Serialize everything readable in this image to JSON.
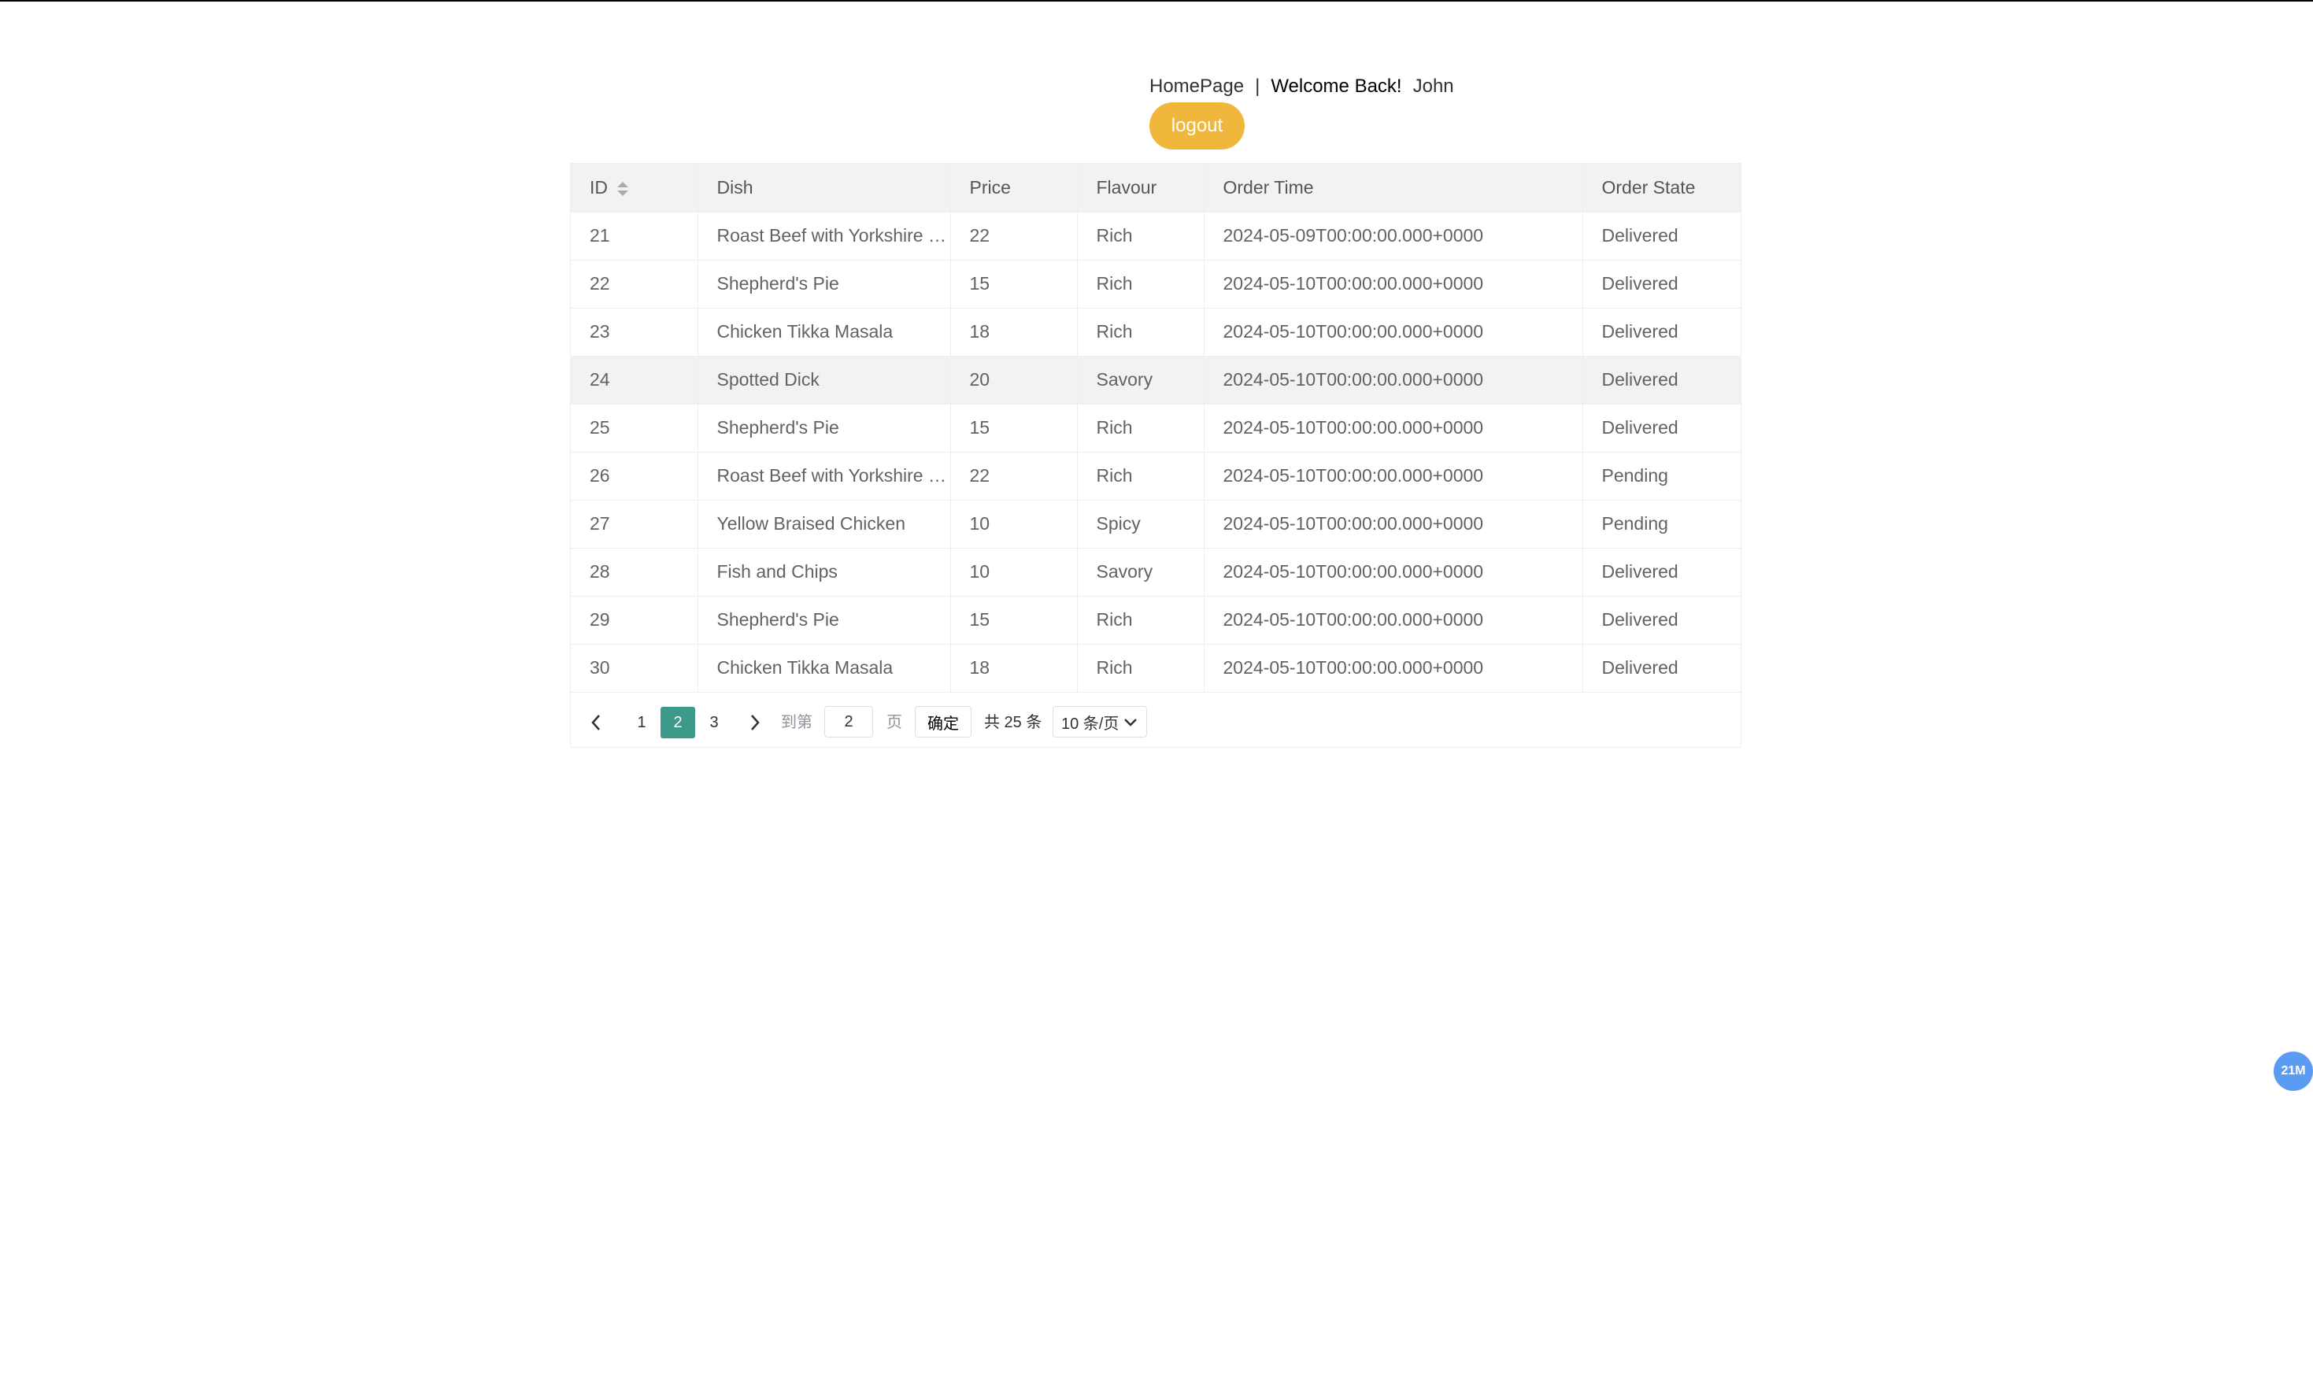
{
  "header": {
    "home": "HomePage",
    "separator": "|",
    "welcome": "Welcome Back!",
    "user": "John",
    "logout": "logout"
  },
  "table": {
    "columns": [
      "ID",
      "Dish",
      "Price",
      "Flavour",
      "Order Time",
      "Order State"
    ],
    "rows": [
      {
        "id": "21",
        "dish": "Roast Beef with Yorkshire Pudding",
        "price": "22",
        "flavour": "Rich",
        "time": "2024-05-09T00:00:00.000+0000",
        "state": "Delivered"
      },
      {
        "id": "22",
        "dish": "Shepherd's Pie",
        "price": "15",
        "flavour": "Rich",
        "time": "2024-05-10T00:00:00.000+0000",
        "state": "Delivered"
      },
      {
        "id": "23",
        "dish": "Chicken Tikka Masala",
        "price": "18",
        "flavour": "Rich",
        "time": "2024-05-10T00:00:00.000+0000",
        "state": "Delivered"
      },
      {
        "id": "24",
        "dish": "Spotted Dick",
        "price": "20",
        "flavour": "Savory",
        "time": "2024-05-10T00:00:00.000+0000",
        "state": "Delivered"
      },
      {
        "id": "25",
        "dish": "Shepherd's Pie",
        "price": "15",
        "flavour": "Rich",
        "time": "2024-05-10T00:00:00.000+0000",
        "state": "Delivered"
      },
      {
        "id": "26",
        "dish": "Roast Beef with Yorkshire Pudding",
        "price": "22",
        "flavour": "Rich",
        "time": "2024-05-10T00:00:00.000+0000",
        "state": "Pending"
      },
      {
        "id": "27",
        "dish": "Yellow Braised Chicken",
        "price": "10",
        "flavour": "Spicy",
        "time": "2024-05-10T00:00:00.000+0000",
        "state": "Pending"
      },
      {
        "id": "28",
        "dish": "Fish and Chips",
        "price": "10",
        "flavour": "Savory",
        "time": "2024-05-10T00:00:00.000+0000",
        "state": "Delivered"
      },
      {
        "id": "29",
        "dish": "Shepherd's Pie",
        "price": "15",
        "flavour": "Rich",
        "time": "2024-05-10T00:00:00.000+0000",
        "state": "Delivered"
      },
      {
        "id": "30",
        "dish": "Chicken Tikka Masala",
        "price": "18",
        "flavour": "Rich",
        "time": "2024-05-10T00:00:00.000+0000",
        "state": "Delivered"
      }
    ]
  },
  "pagination": {
    "pages": [
      "1",
      "2",
      "3"
    ],
    "current": "2",
    "goto_label": "到第",
    "goto_value": "2",
    "page_unit": "页",
    "confirm": "确定",
    "total": "共 25 条",
    "page_size": "10 条/页",
    "prev_icon": "chevron-left-icon",
    "next_icon": "chevron-right-icon"
  },
  "float_badge": "21M",
  "colors": {
    "accent": "#3d9a8b",
    "logout": "#f0b73c",
    "badge": "#5b9cf2"
  }
}
